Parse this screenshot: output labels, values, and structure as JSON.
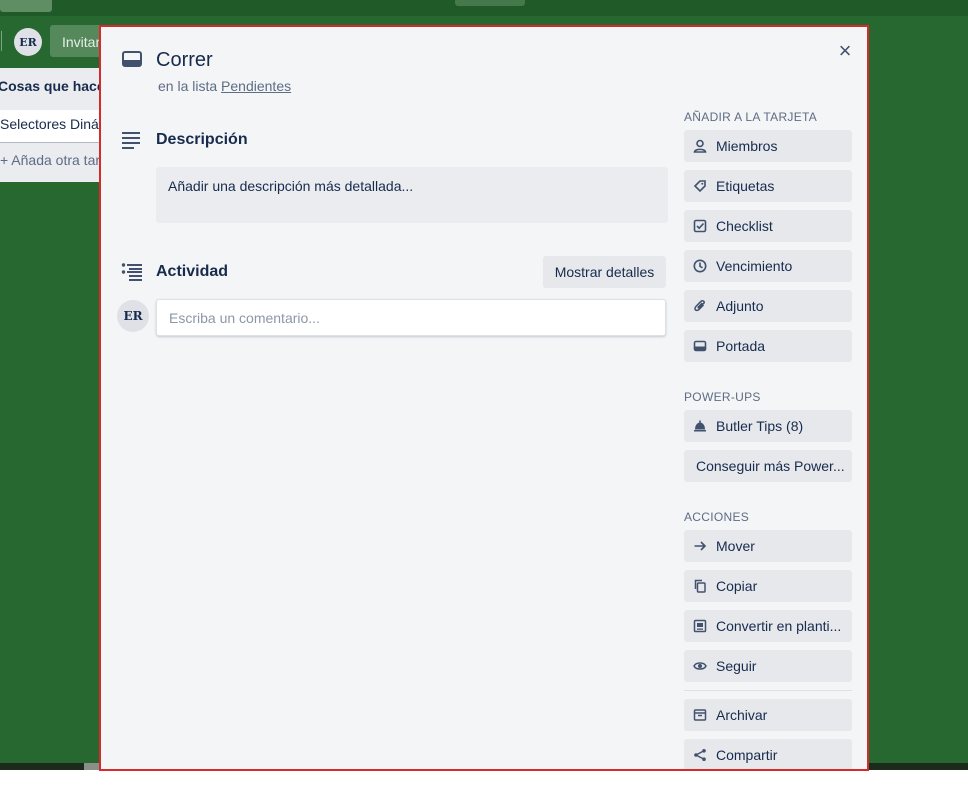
{
  "board": {
    "invite_label": "Invitar",
    "avatar_initials": "ER",
    "list_title": "Cosas que hacer",
    "list_card": "Selectores Dinámicos",
    "list_add": "+ Añada otra tarjeta"
  },
  "card": {
    "title": "Correr",
    "list_prefix": "en la lista",
    "list_name": "Pendientes",
    "close_symbol": "×"
  },
  "description": {
    "heading": "Descripción",
    "placeholder": "Añadir una descripción más detallada..."
  },
  "activity": {
    "heading": "Actividad",
    "show_details": "Mostrar detalles",
    "avatar_initials": "ER",
    "comment_placeholder": "Escriba un comentario..."
  },
  "sidebar": {
    "add_heading": "AÑADIR A LA TARJETA",
    "add_items": [
      {
        "label": "Miembros",
        "icon": "person-icon"
      },
      {
        "label": "Etiquetas",
        "icon": "tag-icon"
      },
      {
        "label": "Checklist",
        "icon": "checkbox-icon"
      },
      {
        "label": "Vencimiento",
        "icon": "clock-icon"
      },
      {
        "label": "Adjunto",
        "icon": "paperclip-icon"
      },
      {
        "label": "Portada",
        "icon": "cover-icon"
      }
    ],
    "powerups_heading": "POWER-UPS",
    "powerups_items": [
      {
        "label": "Butler Tips (8)",
        "icon": "bell-icon"
      },
      {
        "label": "Conseguir más Power...",
        "icon": ""
      }
    ],
    "actions_heading": "ACCIONES",
    "actions_items": [
      {
        "label": "Mover",
        "icon": "arrow-right-icon"
      },
      {
        "label": "Copiar",
        "icon": "copy-icon"
      },
      {
        "label": "Convertir en planti...",
        "icon": "template-icon"
      },
      {
        "label": "Seguir",
        "icon": "eye-icon"
      },
      {
        "label": "Archivar",
        "icon": "archive-icon"
      },
      {
        "label": "Compartir",
        "icon": "share-icon"
      }
    ]
  },
  "colors": {
    "board_bg": "#26682f",
    "modal_bg": "#f4f5f7",
    "modal_border": "#d62b2b",
    "button_bg": "#e6e8eb",
    "text": "#172b4d",
    "muted": "#5e6c84"
  }
}
